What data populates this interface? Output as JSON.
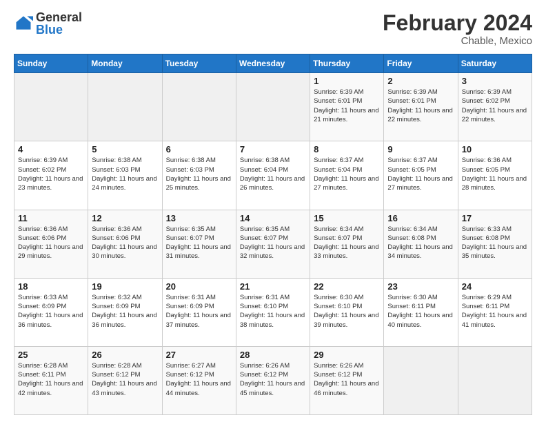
{
  "logo": {
    "general": "General",
    "blue": "Blue"
  },
  "header": {
    "title": "February 2024",
    "subtitle": "Chable, Mexico"
  },
  "weekdays": [
    "Sunday",
    "Monday",
    "Tuesday",
    "Wednesday",
    "Thursday",
    "Friday",
    "Saturday"
  ],
  "weeks": [
    [
      {
        "day": "",
        "info": ""
      },
      {
        "day": "",
        "info": ""
      },
      {
        "day": "",
        "info": ""
      },
      {
        "day": "",
        "info": ""
      },
      {
        "day": "1",
        "info": "Sunrise: 6:39 AM\nSunset: 6:01 PM\nDaylight: 11 hours and 21 minutes."
      },
      {
        "day": "2",
        "info": "Sunrise: 6:39 AM\nSunset: 6:01 PM\nDaylight: 11 hours and 22 minutes."
      },
      {
        "day": "3",
        "info": "Sunrise: 6:39 AM\nSunset: 6:02 PM\nDaylight: 11 hours and 22 minutes."
      }
    ],
    [
      {
        "day": "4",
        "info": "Sunrise: 6:39 AM\nSunset: 6:02 PM\nDaylight: 11 hours and 23 minutes."
      },
      {
        "day": "5",
        "info": "Sunrise: 6:38 AM\nSunset: 6:03 PM\nDaylight: 11 hours and 24 minutes."
      },
      {
        "day": "6",
        "info": "Sunrise: 6:38 AM\nSunset: 6:03 PM\nDaylight: 11 hours and 25 minutes."
      },
      {
        "day": "7",
        "info": "Sunrise: 6:38 AM\nSunset: 6:04 PM\nDaylight: 11 hours and 26 minutes."
      },
      {
        "day": "8",
        "info": "Sunrise: 6:37 AM\nSunset: 6:04 PM\nDaylight: 11 hours and 27 minutes."
      },
      {
        "day": "9",
        "info": "Sunrise: 6:37 AM\nSunset: 6:05 PM\nDaylight: 11 hours and 27 minutes."
      },
      {
        "day": "10",
        "info": "Sunrise: 6:36 AM\nSunset: 6:05 PM\nDaylight: 11 hours and 28 minutes."
      }
    ],
    [
      {
        "day": "11",
        "info": "Sunrise: 6:36 AM\nSunset: 6:06 PM\nDaylight: 11 hours and 29 minutes."
      },
      {
        "day": "12",
        "info": "Sunrise: 6:36 AM\nSunset: 6:06 PM\nDaylight: 11 hours and 30 minutes."
      },
      {
        "day": "13",
        "info": "Sunrise: 6:35 AM\nSunset: 6:07 PM\nDaylight: 11 hours and 31 minutes."
      },
      {
        "day": "14",
        "info": "Sunrise: 6:35 AM\nSunset: 6:07 PM\nDaylight: 11 hours and 32 minutes."
      },
      {
        "day": "15",
        "info": "Sunrise: 6:34 AM\nSunset: 6:07 PM\nDaylight: 11 hours and 33 minutes."
      },
      {
        "day": "16",
        "info": "Sunrise: 6:34 AM\nSunset: 6:08 PM\nDaylight: 11 hours and 34 minutes."
      },
      {
        "day": "17",
        "info": "Sunrise: 6:33 AM\nSunset: 6:08 PM\nDaylight: 11 hours and 35 minutes."
      }
    ],
    [
      {
        "day": "18",
        "info": "Sunrise: 6:33 AM\nSunset: 6:09 PM\nDaylight: 11 hours and 36 minutes."
      },
      {
        "day": "19",
        "info": "Sunrise: 6:32 AM\nSunset: 6:09 PM\nDaylight: 11 hours and 36 minutes."
      },
      {
        "day": "20",
        "info": "Sunrise: 6:31 AM\nSunset: 6:09 PM\nDaylight: 11 hours and 37 minutes."
      },
      {
        "day": "21",
        "info": "Sunrise: 6:31 AM\nSunset: 6:10 PM\nDaylight: 11 hours and 38 minutes."
      },
      {
        "day": "22",
        "info": "Sunrise: 6:30 AM\nSunset: 6:10 PM\nDaylight: 11 hours and 39 minutes."
      },
      {
        "day": "23",
        "info": "Sunrise: 6:30 AM\nSunset: 6:11 PM\nDaylight: 11 hours and 40 minutes."
      },
      {
        "day": "24",
        "info": "Sunrise: 6:29 AM\nSunset: 6:11 PM\nDaylight: 11 hours and 41 minutes."
      }
    ],
    [
      {
        "day": "25",
        "info": "Sunrise: 6:28 AM\nSunset: 6:11 PM\nDaylight: 11 hours and 42 minutes."
      },
      {
        "day": "26",
        "info": "Sunrise: 6:28 AM\nSunset: 6:12 PM\nDaylight: 11 hours and 43 minutes."
      },
      {
        "day": "27",
        "info": "Sunrise: 6:27 AM\nSunset: 6:12 PM\nDaylight: 11 hours and 44 minutes."
      },
      {
        "day": "28",
        "info": "Sunrise: 6:26 AM\nSunset: 6:12 PM\nDaylight: 11 hours and 45 minutes."
      },
      {
        "day": "29",
        "info": "Sunrise: 6:26 AM\nSunset: 6:12 PM\nDaylight: 11 hours and 46 minutes."
      },
      {
        "day": "",
        "info": ""
      },
      {
        "day": "",
        "info": ""
      }
    ]
  ]
}
